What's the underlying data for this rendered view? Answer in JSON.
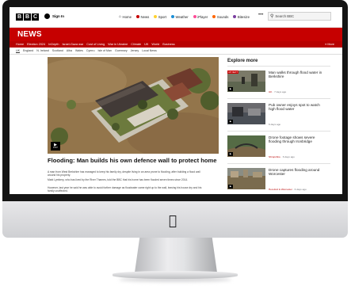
{
  "site": {
    "logo_letters": [
      "B",
      "B",
      "C"
    ],
    "sign_in": "Sign In",
    "top_nav": [
      {
        "label": "Home",
        "icon": "home-icon",
        "color": "#222222"
      },
      {
        "label": "News",
        "icon": "news-dot-icon",
        "color": "#c60000"
      },
      {
        "label": "Sport",
        "icon": "sport-dot-icon",
        "color": "#ffd230"
      },
      {
        "label": "Weather",
        "icon": "weather-dot-icon",
        "color": "#1a8fd6"
      },
      {
        "label": "iPlayer",
        "icon": "iplayer-dot-icon",
        "color": "#ff4c98"
      },
      {
        "label": "Sounds",
        "icon": "sounds-dot-icon",
        "color": "#ff6600"
      },
      {
        "label": "Bitesize",
        "icon": "bitesize-dot-icon",
        "color": "#7b3fa0"
      }
    ],
    "more_label": "•••",
    "search_placeholder": "Search BBC",
    "accent": "#c60000"
  },
  "news": {
    "title": "NEWS",
    "nav": [
      "Home",
      "Election 2024",
      "InDepth",
      "Israel-Gaza war",
      "Cost of Living",
      "War in Ukraine",
      "Climate",
      "UK",
      "World",
      "Business"
    ],
    "more": "More",
    "subnav": [
      "UK",
      "England",
      "N. Ireland",
      "Scotland",
      "Alba",
      "Wales",
      "Cymru",
      "Isle of Man",
      "Guernsey",
      "Jersey",
      "Local News"
    ]
  },
  "article": {
    "video_badge": "▶",
    "video_duration": "0:57",
    "headline": "Flooding: Man builds his own defence wall to protect home",
    "paragraphs": [
      "A man from West Berkshire has managed to keep his family dry, despite living in an area prone to flooding, after building a flood wall around his property.",
      "Mark Lymbery, who has lived by the River Thames, told the BBC that his home has been flooded seven times since 2014.",
      "However, last year he said he was able to avoid further damage as floodwater came right up to the wall, leaving his house dry and his family unaffected."
    ]
  },
  "sidebar": {
    "title": "Explore more",
    "items": [
      {
        "badge": "UP NEXT",
        "headline": "Man walks through flood water in Berkshire",
        "tag": "UK",
        "time": "7 days ago"
      },
      {
        "badge": "",
        "headline": "Pub owner enjoys spot to watch high flood water",
        "tag": "",
        "time": "6 days ago"
      },
      {
        "badge": "",
        "headline": "Drone footage shows severe flooding through Ironbridge",
        "tag": "Shropshire",
        "time": "6 days ago"
      },
      {
        "badge": "",
        "headline": "Drone captures flooding around Worcester",
        "tag": "Hereford & Worcester",
        "time": "6 days ago"
      }
    ]
  }
}
